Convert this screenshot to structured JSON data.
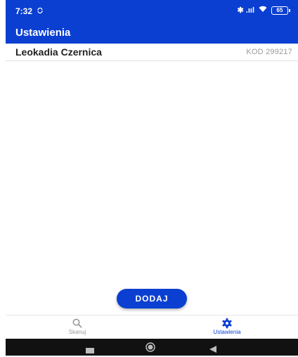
{
  "status_bar": {
    "time": "7:32",
    "sync_icon": "sync-icon",
    "icons_right": "✱ .ııl",
    "battery": "65"
  },
  "app_bar": {
    "title": "Ustawienia"
  },
  "list": {
    "items": [
      {
        "name": "Leokadia Czernica",
        "code": "KOD 299217"
      }
    ]
  },
  "fab": {
    "label": "DODAJ"
  },
  "bottom_nav": {
    "items": [
      {
        "label": "Skanuj",
        "icon": "search-icon",
        "active": false
      },
      {
        "label": "Ustawienia",
        "icon": "gear-icon",
        "active": true
      }
    ]
  },
  "colors": {
    "primary": "#0b3fd2",
    "inactive": "#9a9a9a",
    "system_nav": "#111111"
  }
}
